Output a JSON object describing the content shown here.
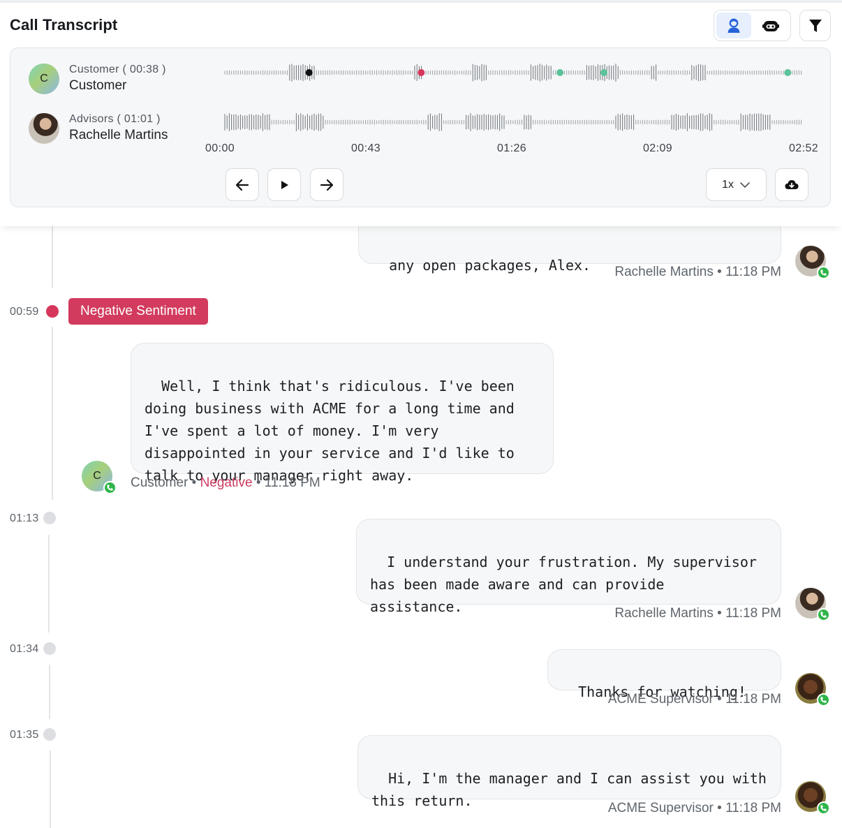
{
  "header": {
    "title": "Call Transcript",
    "view_toggle": [
      {
        "icon": "agent-view-icon",
        "active": true
      },
      {
        "icon": "bot-view-icon",
        "active": false
      }
    ],
    "filter_icon": "filter-icon"
  },
  "player": {
    "speakers": [
      {
        "role_time": "Customer ( 00:38 )",
        "name": "Customer",
        "avatar_initial": "C"
      },
      {
        "role_time": "Advisors ( 01:01 )",
        "name": "Rachelle Martins"
      }
    ],
    "markers": {
      "customer_track": [
        {
          "position": 0.147,
          "color": "#111111"
        },
        {
          "position": 0.341,
          "color": "#d6365c"
        },
        {
          "position": 0.581,
          "color": "#5cc29a"
        },
        {
          "position": 0.657,
          "color": "#5cc29a"
        },
        {
          "position": 0.975,
          "color": "#5cc29a"
        }
      ]
    },
    "time_labels": [
      "00:00",
      "00:43",
      "01:26",
      "02:09",
      "02:52"
    ],
    "speed": "1x",
    "controls": [
      "back-arrow-icon",
      "play-icon",
      "forward-arrow-icon",
      "cloud-download-icon"
    ]
  },
  "transcript": {
    "entries": [
      {
        "text": "any open packages, Alex.",
        "speaker": "Rachelle Martins",
        "time": "11:18 PM"
      },
      {
        "timestamp": "00:59",
        "badge": "Negative Sentiment",
        "text": "Well, I think that's ridiculous. I've been\ndoing business with ACME for a long time and\nI've spent a lot of money. I'm very\ndisappointed in your service and I'd like to\ntalk to your manager right away.",
        "speaker": "Customer",
        "sentiment": "Negative",
        "time": "11:18 PM",
        "avatar_initial": "C"
      },
      {
        "timestamp": "01:13",
        "text": "I understand your frustration. My supervisor\nhas been made aware and can provide\nassistance.",
        "speaker": "Rachelle Martins",
        "time": "11:18 PM"
      },
      {
        "timestamp": "01:34",
        "text": "Thanks for watching!",
        "speaker": "ACME Supervisor",
        "time": "11:18 PM"
      },
      {
        "timestamp": "01:35",
        "text": "Hi, I'm the manager and I can assist you with\nthis return.",
        "speaker": "ACME Supervisor",
        "time": "11:18 PM"
      }
    ],
    "separator": "•"
  },
  "colors": {
    "negative": "#d23b5d",
    "positive_marker": "#5cc29a",
    "online": "#2fb54a",
    "toggle_active": "#e7effd",
    "toggle_icon": "#2563d9"
  }
}
